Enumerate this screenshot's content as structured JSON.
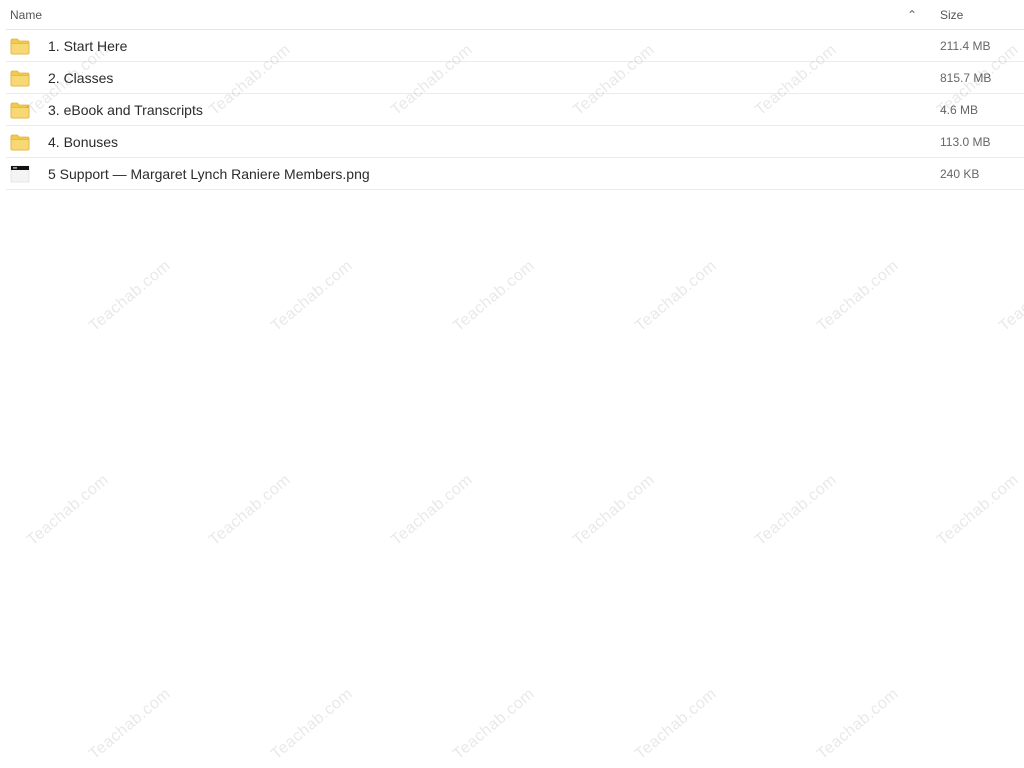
{
  "header": {
    "name_label": "Name",
    "size_label": "Size",
    "sort_icon": "chevron-up-icon"
  },
  "rows": [
    {
      "name": "1. Start Here",
      "size": "211.4 MB",
      "icon": "folder-icon"
    },
    {
      "name": "2. Classes",
      "size": "815.7 MB",
      "icon": "folder-icon"
    },
    {
      "name": "3. eBook and Transcripts",
      "size": "4.6 MB",
      "icon": "folder-icon"
    },
    {
      "name": "4. Bonuses",
      "size": "113.0 MB",
      "icon": "folder-icon"
    },
    {
      "name": "5 Support — Margaret Lynch Raniere Members.png",
      "size": "240 KB",
      "icon": "image-file-icon"
    }
  ],
  "watermark_text": "Teachab.com",
  "colors": {
    "folder_fill": "#f8d775",
    "folder_tab": "#f2c94c",
    "folder_stroke": "#e0b23d"
  }
}
